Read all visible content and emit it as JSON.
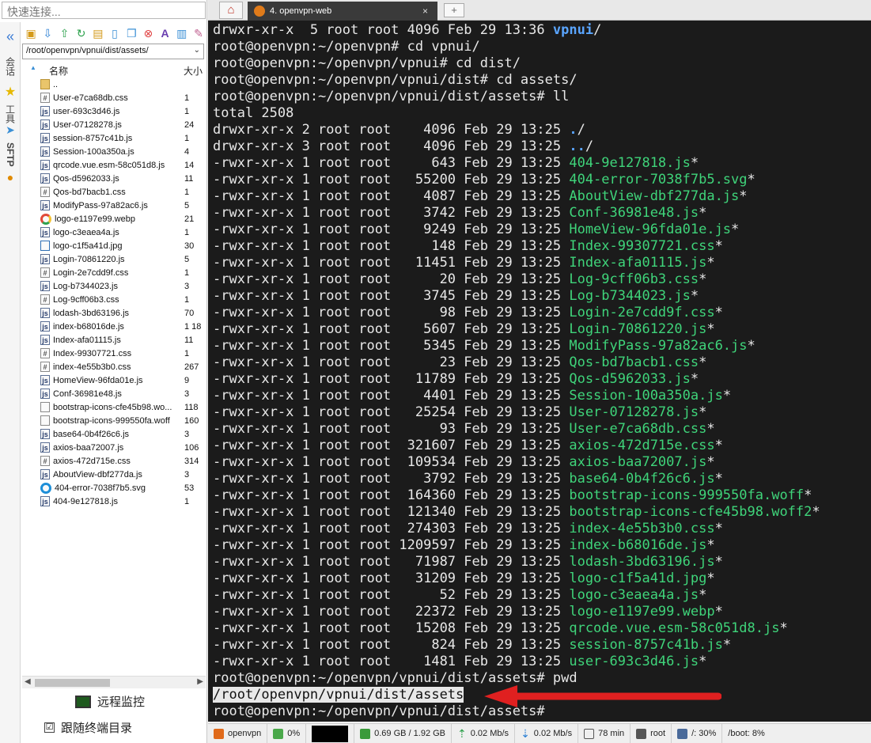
{
  "quick_connect_placeholder": "快速连接...",
  "vertical_tabs": {
    "sessions": "会话",
    "tools": "工具",
    "sftp": "SFTP"
  },
  "sftp_path": "/root/openvpn/vpnui/dist/assets/",
  "file_header": {
    "name": "名称",
    "size": "大小"
  },
  "files": [
    {
      "name": "..",
      "size": "",
      "type": "folder"
    },
    {
      "name": "User-e7ca68db.css",
      "size": "1",
      "type": "css"
    },
    {
      "name": "user-693c3d46.js",
      "size": "1",
      "type": "js"
    },
    {
      "name": "User-07128278.js",
      "size": "24",
      "type": "js"
    },
    {
      "name": "session-8757c41b.js",
      "size": "1",
      "type": "js"
    },
    {
      "name": "Session-100a350a.js",
      "size": "4",
      "type": "js"
    },
    {
      "name": "qrcode.vue.esm-58c051d8.js",
      "size": "14",
      "type": "js"
    },
    {
      "name": "Qos-d5962033.js",
      "size": "11",
      "type": "js"
    },
    {
      "name": "Qos-bd7bacb1.css",
      "size": "1",
      "type": "css"
    },
    {
      "name": "ModifyPass-97a82ac6.js",
      "size": "5",
      "type": "js"
    },
    {
      "name": "logo-e1197e99.webp",
      "size": "21",
      "type": "chrome"
    },
    {
      "name": "logo-c3eaea4a.js",
      "size": "1",
      "type": "js"
    },
    {
      "name": "logo-c1f5a41d.jpg",
      "size": "30",
      "type": "img"
    },
    {
      "name": "Login-70861220.js",
      "size": "5",
      "type": "js"
    },
    {
      "name": "Login-2e7cdd9f.css",
      "size": "1",
      "type": "css"
    },
    {
      "name": "Log-b7344023.js",
      "size": "3",
      "type": "js"
    },
    {
      "name": "Log-9cff06b3.css",
      "size": "1",
      "type": "css"
    },
    {
      "name": "lodash-3bd63196.js",
      "size": "70",
      "type": "js"
    },
    {
      "name": "index-b68016de.js",
      "size": "1 18",
      "type": "js"
    },
    {
      "name": "Index-afa01115.js",
      "size": "11",
      "type": "js"
    },
    {
      "name": "Index-99307721.css",
      "size": "1",
      "type": "css"
    },
    {
      "name": "index-4e55b3b0.css",
      "size": "267",
      "type": "css"
    },
    {
      "name": "HomeView-96fda01e.js",
      "size": "9",
      "type": "js"
    },
    {
      "name": "Conf-36981e48.js",
      "size": "3",
      "type": "js"
    },
    {
      "name": "bootstrap-icons-cfe45b98.wo...",
      "size": "118",
      "type": "file"
    },
    {
      "name": "bootstrap-icons-999550fa.woff",
      "size": "160",
      "type": "file"
    },
    {
      "name": "base64-0b4f26c6.js",
      "size": "3",
      "type": "js"
    },
    {
      "name": "axios-baa72007.js",
      "size": "106",
      "type": "js"
    },
    {
      "name": "axios-472d715e.css",
      "size": "314",
      "type": "css"
    },
    {
      "name": "AboutView-dbf277da.js",
      "size": "3",
      "type": "js"
    },
    {
      "name": "404-error-7038f7b5.svg",
      "size": "53",
      "type": "edge"
    },
    {
      "name": "404-9e127818.js",
      "size": "1",
      "type": "js"
    }
  ],
  "remote_monitor_label": "远程监控",
  "follow_terminal_label": "跟随终端目录",
  "follow_terminal_checked": "☑",
  "tabs": {
    "active_tab_label": "4. openvpn-web",
    "close": "×",
    "new": "+"
  },
  "terminal_lines": [
    {
      "pre": "drwxr-xr-x  5 root root 4096 Feb 29 13:36 ",
      "name": "vpnui",
      "post": "/",
      "color": "blue"
    },
    {
      "pre": "root@openvpn:~/openvpn# cd vpnui/",
      "name": "",
      "post": "",
      "color": ""
    },
    {
      "pre": "root@openvpn:~/openvpn/vpnui# cd dist/",
      "name": "",
      "post": "",
      "color": ""
    },
    {
      "pre": "root@openvpn:~/openvpn/vpnui/dist# cd assets/",
      "name": "",
      "post": "",
      "color": ""
    },
    {
      "pre": "root@openvpn:~/openvpn/vpnui/dist/assets# ll",
      "name": "",
      "post": "",
      "color": ""
    },
    {
      "pre": "total 2508",
      "name": "",
      "post": "",
      "color": ""
    },
    {
      "pre": "drwxr-xr-x 2 root root    4096 Feb 29 13:25 ",
      "name": ".",
      "post": "/",
      "color": "blue"
    },
    {
      "pre": "drwxr-xr-x 3 root root    4096 Feb 29 13:25 ",
      "name": "..",
      "post": "/",
      "color": "blue"
    },
    {
      "pre": "-rwxr-xr-x 1 root root     643 Feb 29 13:25 ",
      "name": "404-9e127818.js",
      "post": "*",
      "color": "green"
    },
    {
      "pre": "-rwxr-xr-x 1 root root   55200 Feb 29 13:25 ",
      "name": "404-error-7038f7b5.svg",
      "post": "*",
      "color": "green"
    },
    {
      "pre": "-rwxr-xr-x 1 root root    4087 Feb 29 13:25 ",
      "name": "AboutView-dbf277da.js",
      "post": "*",
      "color": "green"
    },
    {
      "pre": "-rwxr-xr-x 1 root root    3742 Feb 29 13:25 ",
      "name": "Conf-36981e48.js",
      "post": "*",
      "color": "green"
    },
    {
      "pre": "-rwxr-xr-x 1 root root    9249 Feb 29 13:25 ",
      "name": "HomeView-96fda01e.js",
      "post": "*",
      "color": "green"
    },
    {
      "pre": "-rwxr-xr-x 1 root root     148 Feb 29 13:25 ",
      "name": "Index-99307721.css",
      "post": "*",
      "color": "green"
    },
    {
      "pre": "-rwxr-xr-x 1 root root   11451 Feb 29 13:25 ",
      "name": "Index-afa01115.js",
      "post": "*",
      "color": "green"
    },
    {
      "pre": "-rwxr-xr-x 1 root root      20 Feb 29 13:25 ",
      "name": "Log-9cff06b3.css",
      "post": "*",
      "color": "green"
    },
    {
      "pre": "-rwxr-xr-x 1 root root    3745 Feb 29 13:25 ",
      "name": "Log-b7344023.js",
      "post": "*",
      "color": "green"
    },
    {
      "pre": "-rwxr-xr-x 1 root root      98 Feb 29 13:25 ",
      "name": "Login-2e7cdd9f.css",
      "post": "*",
      "color": "green"
    },
    {
      "pre": "-rwxr-xr-x 1 root root    5607 Feb 29 13:25 ",
      "name": "Login-70861220.js",
      "post": "*",
      "color": "green"
    },
    {
      "pre": "-rwxr-xr-x 1 root root    5345 Feb 29 13:25 ",
      "name": "ModifyPass-97a82ac6.js",
      "post": "*",
      "color": "green"
    },
    {
      "pre": "-rwxr-xr-x 1 root root      23 Feb 29 13:25 ",
      "name": "Qos-bd7bacb1.css",
      "post": "*",
      "color": "green"
    },
    {
      "pre": "-rwxr-xr-x 1 root root   11789 Feb 29 13:25 ",
      "name": "Qos-d5962033.js",
      "post": "*",
      "color": "green"
    },
    {
      "pre": "-rwxr-xr-x 1 root root    4401 Feb 29 13:25 ",
      "name": "Session-100a350a.js",
      "post": "*",
      "color": "green"
    },
    {
      "pre": "-rwxr-xr-x 1 root root   25254 Feb 29 13:25 ",
      "name": "User-07128278.js",
      "post": "*",
      "color": "green"
    },
    {
      "pre": "-rwxr-xr-x 1 root root      93 Feb 29 13:25 ",
      "name": "User-e7ca68db.css",
      "post": "*",
      "color": "green"
    },
    {
      "pre": "-rwxr-xr-x 1 root root  321607 Feb 29 13:25 ",
      "name": "axios-472d715e.css",
      "post": "*",
      "color": "green"
    },
    {
      "pre": "-rwxr-xr-x 1 root root  109534 Feb 29 13:25 ",
      "name": "axios-baa72007.js",
      "post": "*",
      "color": "green"
    },
    {
      "pre": "-rwxr-xr-x 1 root root    3792 Feb 29 13:25 ",
      "name": "base64-0b4f26c6.js",
      "post": "*",
      "color": "green"
    },
    {
      "pre": "-rwxr-xr-x 1 root root  164360 Feb 29 13:25 ",
      "name": "bootstrap-icons-999550fa.woff",
      "post": "*",
      "color": "green"
    },
    {
      "pre": "-rwxr-xr-x 1 root root  121340 Feb 29 13:25 ",
      "name": "bootstrap-icons-cfe45b98.woff2",
      "post": "*",
      "color": "green"
    },
    {
      "pre": "-rwxr-xr-x 1 root root  274303 Feb 29 13:25 ",
      "name": "index-4e55b3b0.css",
      "post": "*",
      "color": "green"
    },
    {
      "pre": "-rwxr-xr-x 1 root root 1209597 Feb 29 13:25 ",
      "name": "index-b68016de.js",
      "post": "*",
      "color": "green"
    },
    {
      "pre": "-rwxr-xr-x 1 root root   71987 Feb 29 13:25 ",
      "name": "lodash-3bd63196.js",
      "post": "*",
      "color": "green"
    },
    {
      "pre": "-rwxr-xr-x 1 root root   31209 Feb 29 13:25 ",
      "name": "logo-c1f5a41d.jpg",
      "post": "*",
      "color": "green"
    },
    {
      "pre": "-rwxr-xr-x 1 root root      52 Feb 29 13:25 ",
      "name": "logo-c3eaea4a.js",
      "post": "*",
      "color": "green"
    },
    {
      "pre": "-rwxr-xr-x 1 root root   22372 Feb 29 13:25 ",
      "name": "logo-e1197e99.webp",
      "post": "*",
      "color": "green"
    },
    {
      "pre": "-rwxr-xr-x 1 root root   15208 Feb 29 13:25 ",
      "name": "qrcode.vue.esm-58c051d8.js",
      "post": "*",
      "color": "green"
    },
    {
      "pre": "-rwxr-xr-x 1 root root     824 Feb 29 13:25 ",
      "name": "session-8757c41b.js",
      "post": "*",
      "color": "green"
    },
    {
      "pre": "-rwxr-xr-x 1 root root    1481 Feb 29 13:25 ",
      "name": "user-693c3d46.js",
      "post": "*",
      "color": "green"
    },
    {
      "pre": "root@openvpn:~/openvpn/vpnui/dist/assets# pwd",
      "name": "",
      "post": "",
      "color": ""
    },
    {
      "pre": "",
      "name": "/root/openvpn/vpnui/dist/assets",
      "post": "",
      "color": "hl"
    },
    {
      "pre": "root@openvpn:~/openvpn/vpnui/dist/assets# ",
      "name": "",
      "post": "",
      "color": ""
    }
  ],
  "status_bar": {
    "host": "openvpn",
    "cpu": "0%",
    "memory": "0.69 GB / 1.92 GB",
    "upload": "0.02 Mb/s",
    "download": "0.02 Mb/s",
    "uptime": "78 min",
    "user": "root",
    "disk_root": "/: 30%",
    "disk_boot": "/boot: 8%"
  },
  "colors": {
    "terminal_bg": "#1b1b1b",
    "dir_blue": "#5aa5ff",
    "exec_green": "#3fd47a",
    "arrow_red": "#e02020"
  }
}
